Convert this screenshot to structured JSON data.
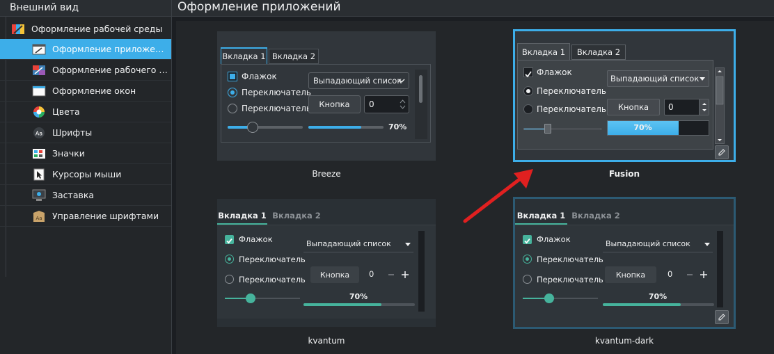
{
  "sidebar": {
    "title": "Внешний вид",
    "items": [
      {
        "label": "Оформление рабочей среды",
        "icon": "workspace-theme-icon"
      },
      {
        "label": "Оформление приложе…",
        "icon": "app-style-icon"
      },
      {
        "label": "Оформление рабочего …",
        "icon": "plasma-style-icon"
      },
      {
        "label": "Оформление окон",
        "icon": "window-decoration-icon"
      },
      {
        "label": "Цвета",
        "icon": "colors-icon"
      },
      {
        "label": "Шрифты",
        "icon": "fonts-icon"
      },
      {
        "label": "Значки",
        "icon": "icons-icon"
      },
      {
        "label": "Курсоры мыши",
        "icon": "cursor-icon"
      },
      {
        "label": "Заставка",
        "icon": "splash-icon"
      },
      {
        "label": "Управление шрифтами",
        "icon": "font-management-icon"
      }
    ]
  },
  "main": {
    "title": "Оформление приложений"
  },
  "preview": {
    "tab1": "Вкладка 1",
    "tab2": "Вкладка 2",
    "checkbox": "Флажок",
    "radio": "Переключатель",
    "dropdown": "Выпадающий список",
    "button": "Кнопка",
    "spin_value": "0",
    "progress": "70%",
    "progress_fraction": 0.7
  },
  "styles": [
    {
      "name": "Breeze"
    },
    {
      "name": "Fusion",
      "selected": true
    },
    {
      "name": "kvantum"
    },
    {
      "name": "kvantum-dark"
    }
  ],
  "colors": {
    "accent": "#3daee9",
    "kvantum_accent": "#46b39c",
    "annotation_arrow": "#e02020"
  }
}
